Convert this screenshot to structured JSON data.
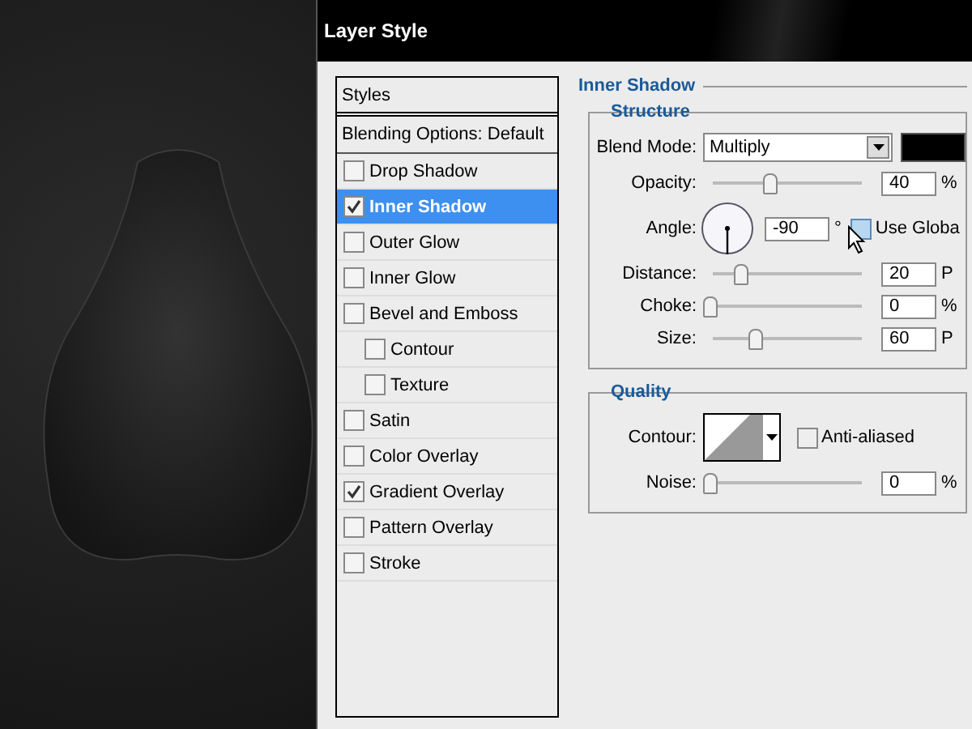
{
  "window": {
    "title": "Layer Style"
  },
  "styles_list": {
    "header": "Styles",
    "blending_options": "Blending Options: Default",
    "items": [
      {
        "label": "Drop Shadow",
        "checked": false,
        "selected": false
      },
      {
        "label": "Inner Shadow",
        "checked": true,
        "selected": true
      },
      {
        "label": "Outer Glow",
        "checked": false,
        "selected": false
      },
      {
        "label": "Inner Glow",
        "checked": false,
        "selected": false
      },
      {
        "label": "Bevel and Emboss",
        "checked": false,
        "selected": false,
        "children": [
          {
            "label": "Contour",
            "checked": false,
            "selected": false
          },
          {
            "label": "Texture",
            "checked": false,
            "selected": false
          }
        ]
      },
      {
        "label": "Satin",
        "checked": false,
        "selected": false
      },
      {
        "label": "Color Overlay",
        "checked": false,
        "selected": false
      },
      {
        "label": "Gradient Overlay",
        "checked": true,
        "selected": false
      },
      {
        "label": "Pattern Overlay",
        "checked": false,
        "selected": false
      },
      {
        "label": "Stroke",
        "checked": false,
        "selected": false
      }
    ]
  },
  "panel": {
    "title": "Inner Shadow",
    "structure": {
      "title": "Structure",
      "blend_mode": {
        "label": "Blend Mode:",
        "value": "Multiply"
      },
      "rows": [
        {
          "kind": "slider",
          "label": "Opacity:",
          "level": 0.39,
          "value": "40",
          "unit": "%"
        },
        {
          "kind": "angle",
          "label": "Angle:",
          "value": "-90",
          "unit": "°",
          "use_global": {
            "label": "Use Globa",
            "checked": false
          }
        },
        {
          "kind": "slider",
          "label": "Distance:",
          "level": 0.2,
          "value": "20",
          "unit": "P"
        },
        {
          "kind": "slider",
          "label": "Choke:",
          "level": 0,
          "value": "0",
          "unit": "%"
        },
        {
          "kind": "slider",
          "label": "Size:",
          "level": 0.29,
          "value": "60",
          "unit": "P"
        }
      ]
    },
    "quality": {
      "title": "Quality",
      "contour": {
        "label": "Contour:"
      },
      "anti_aliased": {
        "label": "Anti-aliased",
        "checked": false
      },
      "noise": {
        "label": "Noise:",
        "level": 0,
        "value": "0",
        "unit": "%"
      }
    }
  }
}
